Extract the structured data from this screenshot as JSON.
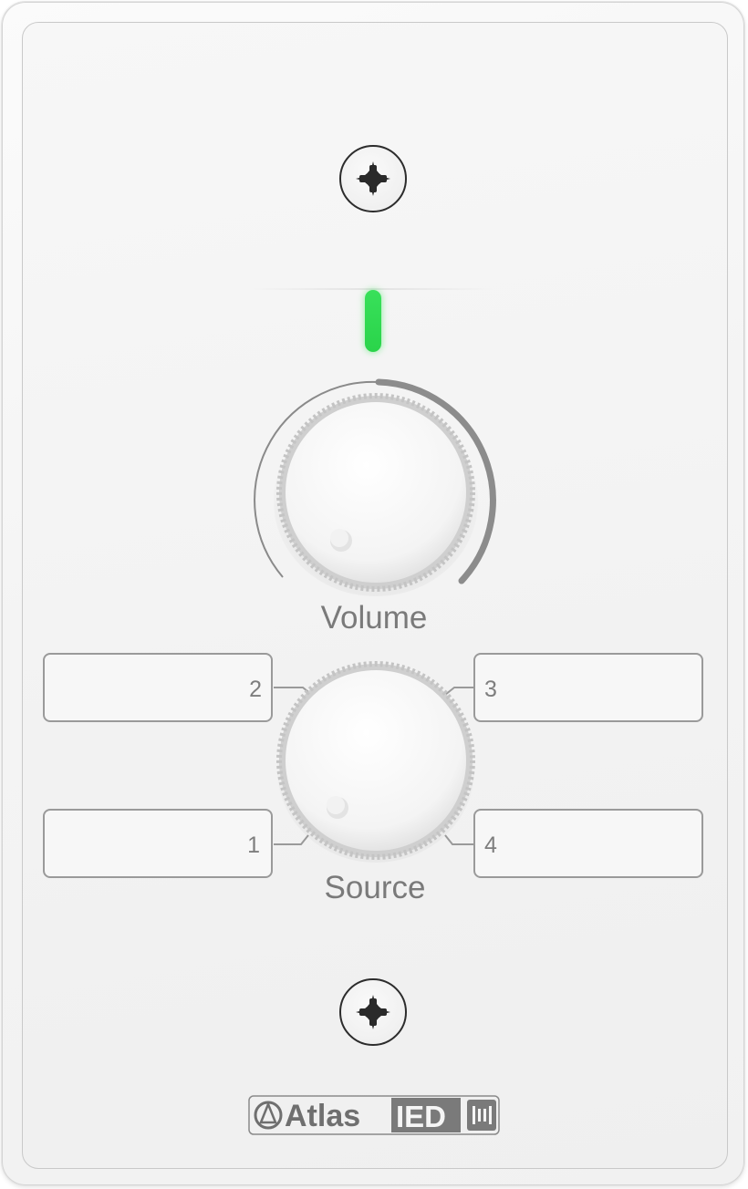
{
  "device": {
    "name": "",
    "volume_label": "Volume",
    "source_label": "Source",
    "led_color": "#2ad44a"
  },
  "sources": [
    {
      "number": "1"
    },
    {
      "number": "2"
    },
    {
      "number": "3"
    },
    {
      "number": "4"
    }
  ],
  "brand": {
    "logo_text_atlas": "Atlas",
    "logo_text_ied": "IED"
  },
  "colors": {
    "plate": "#f4f4f4",
    "label_text": "#7a7a7a",
    "box_border": "#9a9a9a"
  }
}
